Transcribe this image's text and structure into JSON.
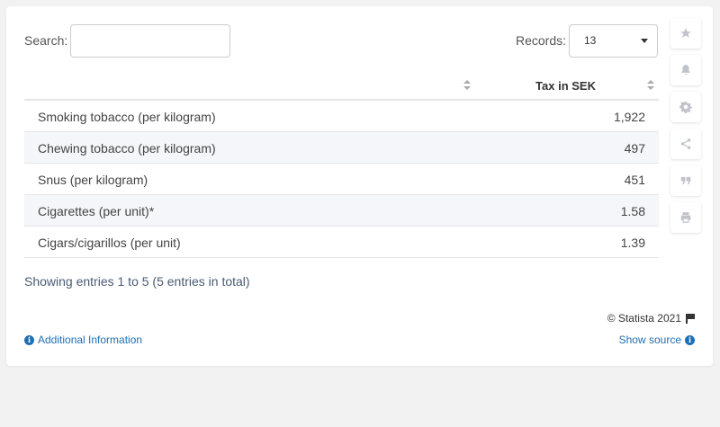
{
  "search": {
    "label": "Search:",
    "value": "",
    "placeholder": ""
  },
  "records": {
    "label": "Records:",
    "value": "13"
  },
  "table": {
    "columns": [
      "",
      "Tax in SEK"
    ],
    "rows": [
      {
        "name": "Smoking tobacco (per kilogram)",
        "value": "1,922"
      },
      {
        "name": "Chewing tobacco (per kilogram)",
        "value": "497"
      },
      {
        "name": "Snus (per kilogram)",
        "value": "451"
      },
      {
        "name": "Cigarettes (per unit)*",
        "value": "1.58"
      },
      {
        "name": "Cigars/cigarillos (per unit)",
        "value": "1.39"
      }
    ]
  },
  "footer": {
    "showing": "Showing entries 1 to 5 (5 entries in total)",
    "copyright": "© Statista 2021",
    "additional_info": "Additional Information",
    "show_source": "Show source"
  },
  "sidebar_icons": [
    "star-icon",
    "bell-icon",
    "gear-icon",
    "share-icon",
    "quote-icon",
    "print-icon"
  ],
  "colors": {
    "link": "#1f6fb5",
    "alt_row": "#f4f6f9",
    "icon": "#c0c4ca"
  },
  "chart_data": {
    "type": "table",
    "columns": [
      "",
      "Tax in SEK"
    ],
    "categories": [
      "Smoking tobacco (per kilogram)",
      "Chewing tobacco (per kilogram)",
      "Snus (per kilogram)",
      "Cigarettes (per unit)*",
      "Cigars/cigarillos (per unit)"
    ],
    "values": [
      1922,
      497,
      451,
      1.58,
      1.39
    ]
  }
}
